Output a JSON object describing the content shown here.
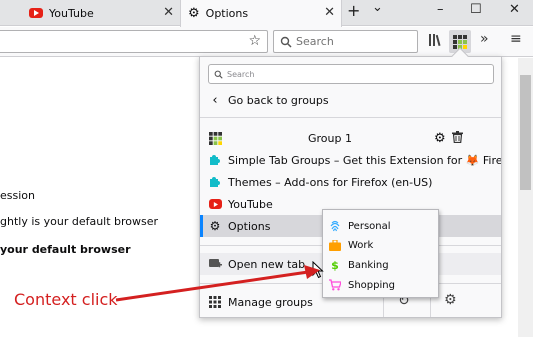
{
  "tabs": [
    {
      "label": "YouTube",
      "icon": "youtube-icon"
    },
    {
      "label": "Options",
      "icon": "gear-icon",
      "active": true
    }
  ],
  "window_controls": {
    "new_tab": "+",
    "list": "⌄",
    "minimize": "–",
    "maximize": "☐",
    "close": "✕"
  },
  "navbar": {
    "search_placeholder": "Search"
  },
  "page": {
    "lines": [
      {
        "text": "ession",
        "bold": false
      },
      {
        "text": "ghtly is your default browser",
        "bold": false
      },
      {
        "text": "your default browser",
        "bold": true
      }
    ]
  },
  "panel": {
    "search_placeholder": "Search",
    "back_label": "Go back to groups",
    "group_title": "Group 1",
    "tabs": [
      {
        "label": "Simple Tab Groups – Get this Extension for 🦊 Fire...",
        "icon": "puzzle-icon"
      },
      {
        "label": "Themes – Add-ons for Firefox (en-US)",
        "icon": "puzzle-icon"
      },
      {
        "label": "YouTube",
        "icon": "youtube-icon"
      },
      {
        "label": "Options",
        "icon": "gear-icon",
        "selected": true
      }
    ],
    "open_new_tab": "Open new tab",
    "manage_groups": "Manage groups"
  },
  "context_menu": {
    "items": [
      {
        "label": "Personal",
        "icon": "fingerprint-icon",
        "color": "#37adff"
      },
      {
        "label": "Work",
        "icon": "briefcase-icon",
        "color": "#ff9f00"
      },
      {
        "label": "Banking",
        "icon": "dollar-icon",
        "color": "#51cd00"
      },
      {
        "label": "Shopping",
        "icon": "cart-icon",
        "color": "#ff4bda"
      }
    ]
  },
  "annotation": {
    "label": "Context click",
    "color": "#d42020"
  },
  "colors": {
    "accent": "#0a84ff",
    "selected_row": "#d7d7db"
  }
}
